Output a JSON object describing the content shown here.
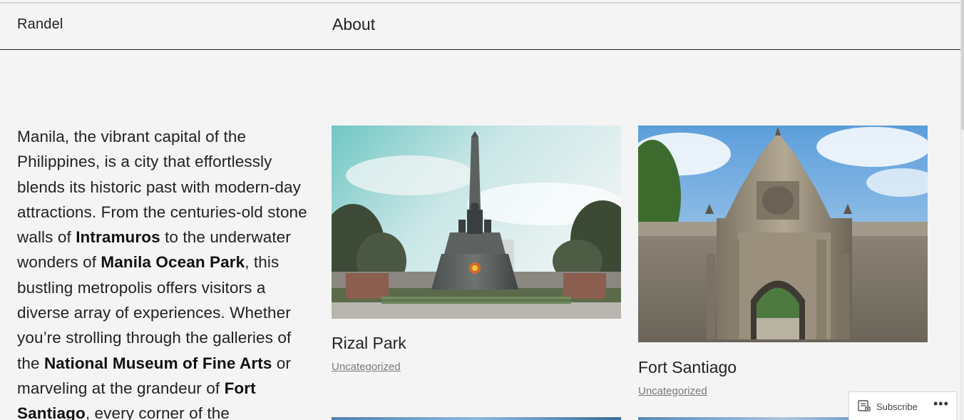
{
  "header": {
    "site_title": "Randel",
    "nav": [
      {
        "label": "About"
      }
    ]
  },
  "intro": {
    "segments": [
      {
        "text": "Manila, the vibrant capital of the Philippines, is a city that effortlessly blends its historic past with modern-day attractions. From the centuries-old stone walls of ",
        "bold": false
      },
      {
        "text": "Intramuros",
        "bold": true
      },
      {
        "text": " to the underwater wonders of ",
        "bold": false
      },
      {
        "text": "Manila Ocean Park",
        "bold": true
      },
      {
        "text": ", this bustling metropolis offers visitors a diverse array of experiences. Whether you’re strolling through the galleries of the ",
        "bold": false
      },
      {
        "text": "National Museum of Fine Arts",
        "bold": true
      },
      {
        "text": " or marveling at the grandeur of ",
        "bold": false
      },
      {
        "text": "Fort Santiago",
        "bold": true
      },
      {
        "text": ", every corner of the",
        "bold": false
      }
    ]
  },
  "posts": [
    {
      "title": "Rizal Park",
      "category": "Uncategorized"
    },
    {
      "title": "Fort Santiago",
      "category": "Uncategorized"
    }
  ],
  "subscribe_bar": {
    "subscribe_label": "Subscribe",
    "more_label": "•••",
    "icon": "reader-icon"
  },
  "colors": {
    "background": "#f4f4f4",
    "text": "#222222",
    "muted": "#7a7a7a"
  }
}
